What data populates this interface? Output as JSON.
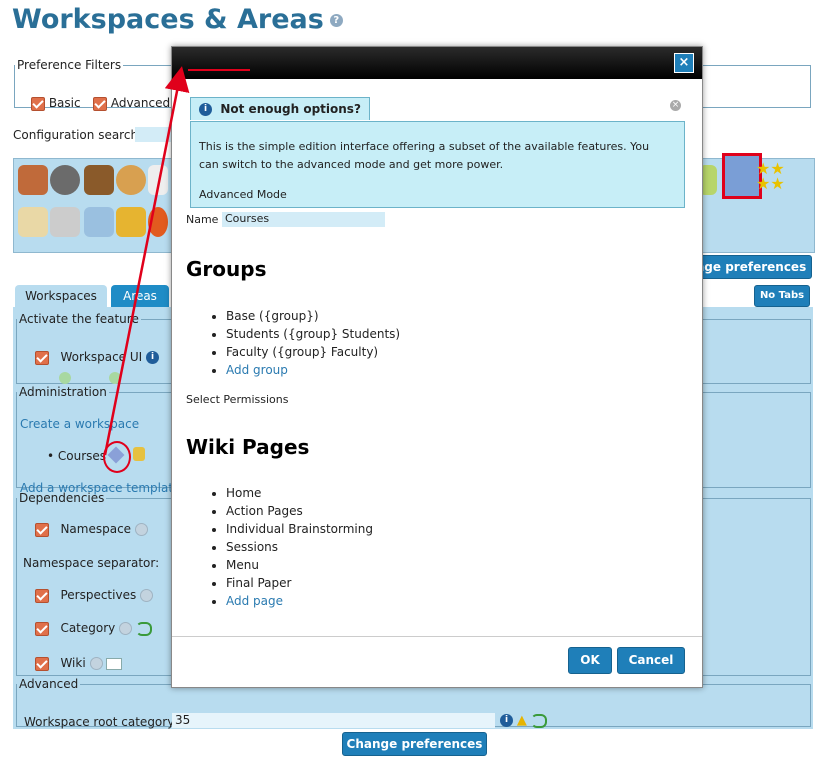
{
  "page": {
    "title": "Workspaces & Areas"
  },
  "preference_filters": {
    "legend": "Preference Filters",
    "basic": "Basic",
    "advanced": "Advanced"
  },
  "config_search": {
    "label": "Configuration search:"
  },
  "change_prefs_top": "nge preferences",
  "tabs": [
    {
      "label": "Workspaces"
    },
    {
      "label": "Areas"
    }
  ],
  "no_tabs": "No Tabs",
  "activate": {
    "legend": "Activate the feature",
    "workspace_ui": "Workspace UI"
  },
  "administration": {
    "legend": "Administration",
    "create": "Create a workspace",
    "item": "Courses",
    "add_template": "Add a workspace template"
  },
  "dependencies": {
    "legend": "Dependencies",
    "namespace": "Namespace",
    "separator": "Namespace separator:",
    "perspectives": "Perspectives",
    "category": "Category",
    "wiki": "Wiki"
  },
  "advanced": {
    "legend": "Advanced",
    "root_label": "Workspace root category:",
    "root_value": "35"
  },
  "change_prefs_bottom": "Change preferences",
  "modal": {
    "alert_title": "Not enough options?",
    "alert_text": "This is the simple edition interface offering a subset of the available features. You can switch to the advanced mode and get more power.",
    "advanced_mode": "Advanced Mode",
    "name_label": "Name",
    "name_value": "Courses",
    "groups_heading": "Groups",
    "groups": [
      "Base ({group})",
      "Students ({group} Students)",
      "Faculty ({group} Faculty)"
    ],
    "add_group": "Add group",
    "select_permissions": "Select Permissions",
    "wiki_heading": "Wiki Pages",
    "pages": [
      "Home",
      "Action Pages",
      "Individual Brainstorming",
      "Sessions",
      "Menu",
      "Final Paper"
    ],
    "add_page": "Add page",
    "ok": "OK",
    "cancel": "Cancel"
  },
  "colors": {
    "accent": "#1f7fb9",
    "panel": "#b8dcef",
    "alert_bg": "#c7eef7",
    "annotation": "#e0001b"
  }
}
